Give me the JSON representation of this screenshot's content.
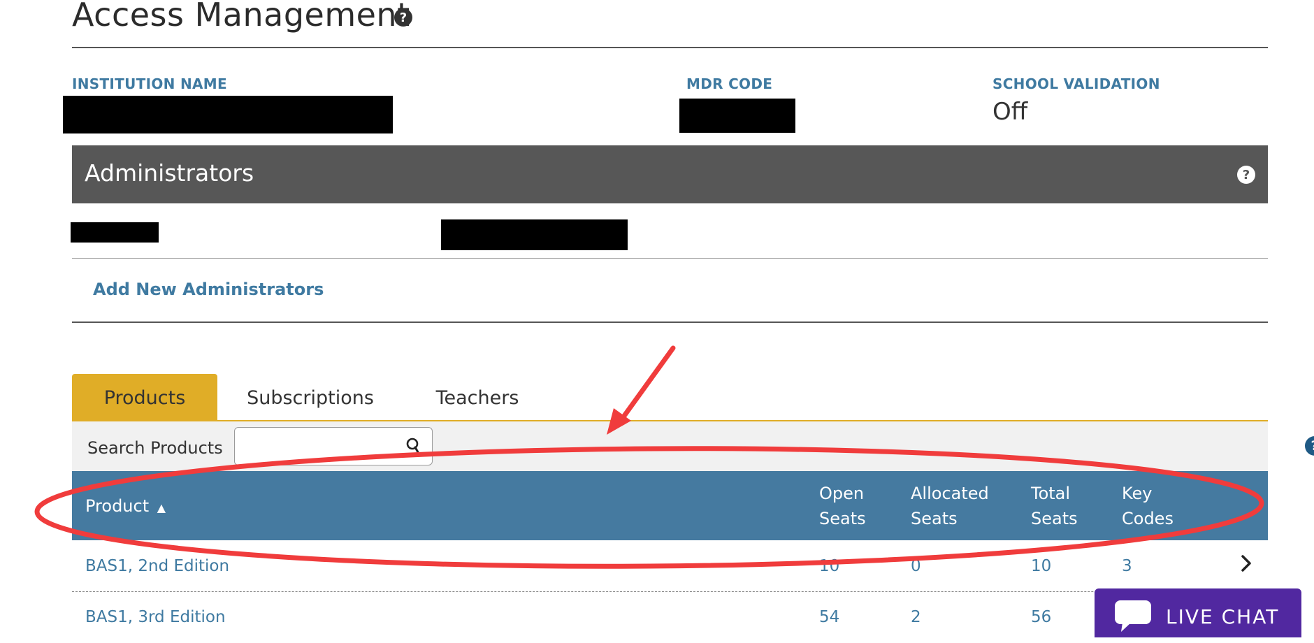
{
  "page": {
    "title": "Access Management"
  },
  "institution": {
    "name_label": "INSTITUTION NAME",
    "mdr_label": "MDR CODE",
    "validation_label": "SCHOOL VALIDATION",
    "validation_value": "Off"
  },
  "administrators": {
    "title": "Administrators",
    "add_link": "Add New Administrators"
  },
  "tabs": [
    {
      "label": "Products",
      "active": true
    },
    {
      "label": "Subscriptions",
      "active": false
    },
    {
      "label": "Teachers",
      "active": false
    }
  ],
  "search": {
    "label": "Search Products",
    "value": "",
    "placeholder": ""
  },
  "table": {
    "headers": {
      "product": "Product",
      "sort_indicator": "▲",
      "open_seats": [
        "Open",
        "Seats"
      ],
      "allocated_seats": [
        "Allocated",
        "Seats"
      ],
      "total_seats": [
        "Total",
        "Seats"
      ],
      "key_codes": [
        "Key",
        "Codes"
      ]
    },
    "rows": [
      {
        "product": "BAS1, 2nd Edition",
        "open_seats": "10",
        "allocated_seats": "0",
        "total_seats": "10",
        "key_codes": "3"
      },
      {
        "product": "BAS1, 3rd Edition",
        "open_seats": "54",
        "allocated_seats": "2",
        "total_seats": "56",
        "key_codes": ""
      }
    ]
  },
  "live_chat": {
    "label": "LIVE CHAT"
  },
  "colors": {
    "accent_blue": "#457aa0",
    "link_blue": "#3f7aa1",
    "tab_gold": "#e0ad27",
    "admin_bar": "#575757",
    "annotation_red": "#f03c3c",
    "chat_purple": "#5128a0"
  },
  "icons": {
    "help": "question-circle-icon",
    "search": "magnifier-icon",
    "row_arrow": "chevron-right-icon",
    "chat": "speech-bubble-icon"
  }
}
